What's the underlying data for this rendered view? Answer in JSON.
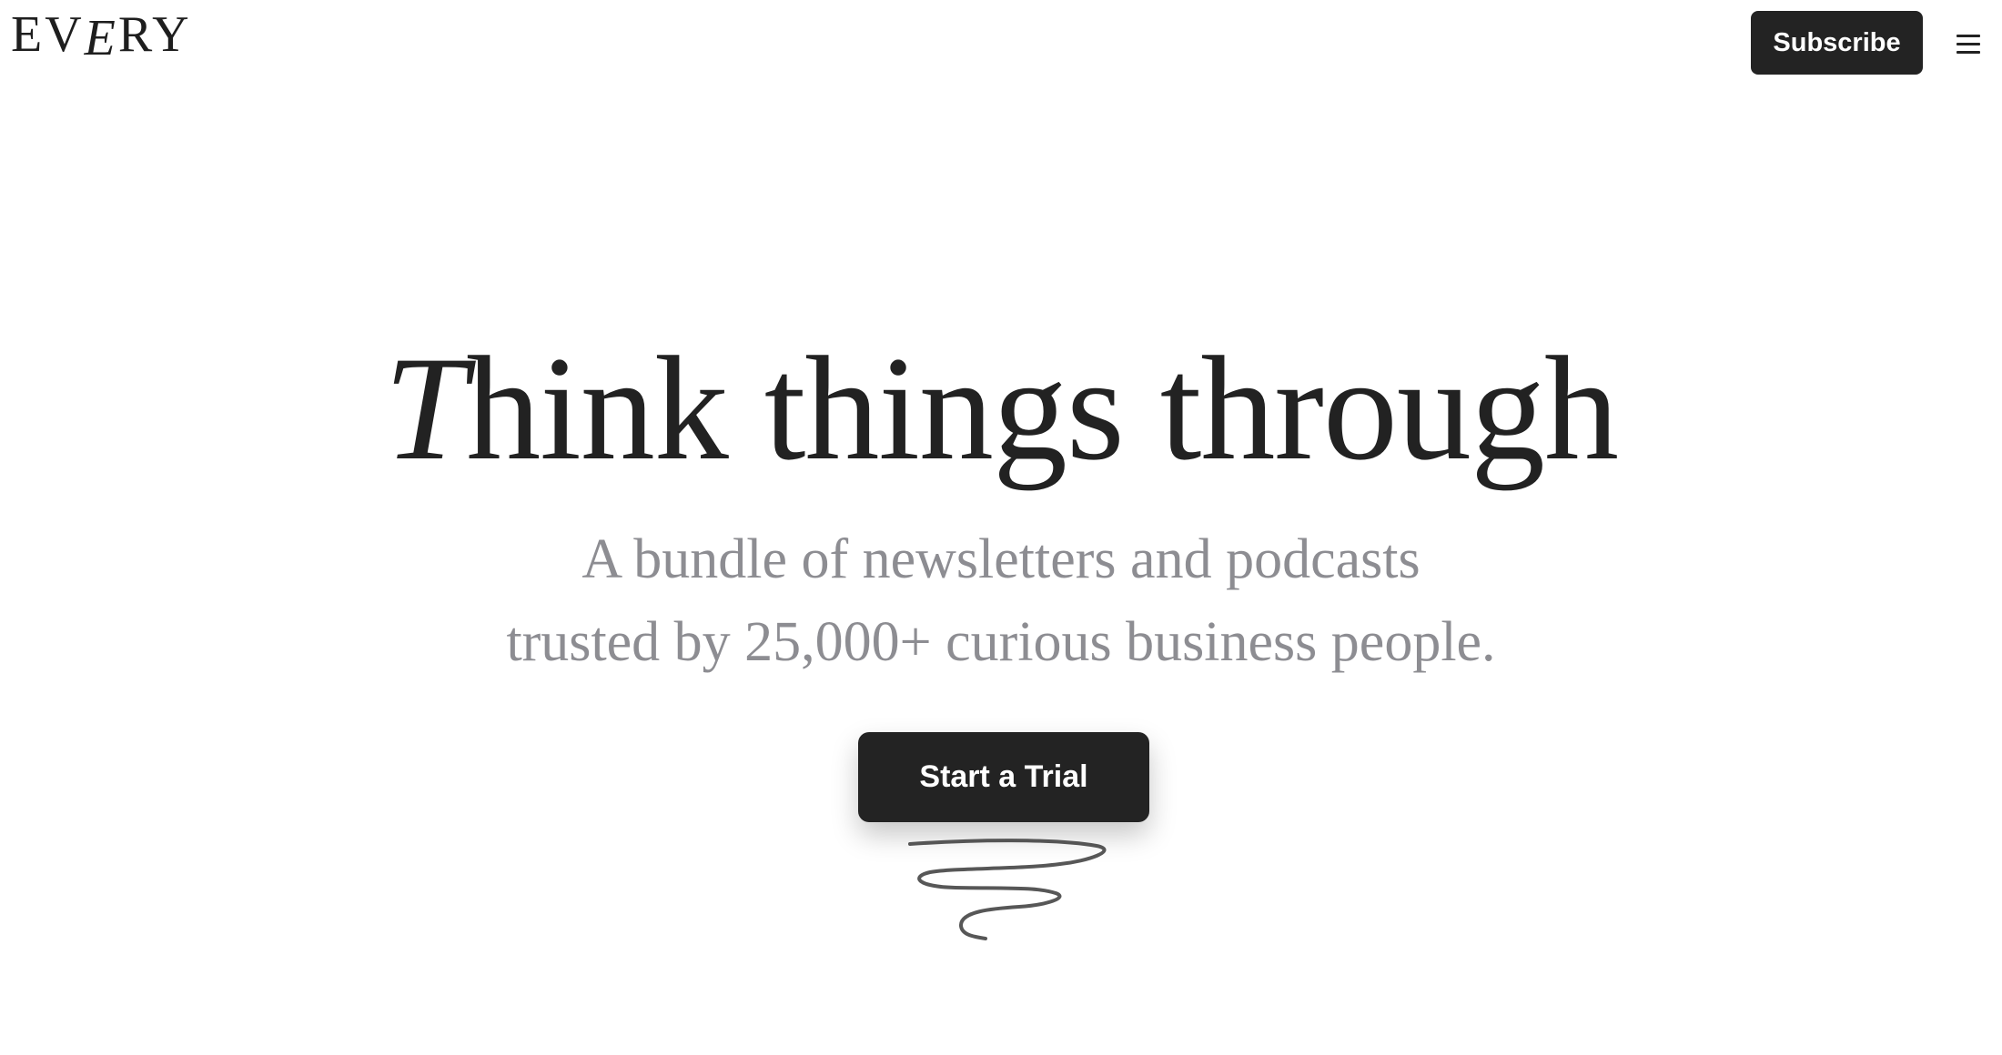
{
  "header": {
    "logo": {
      "pre": "EV",
      "special": "E",
      "post": "RY"
    },
    "subscribe_label": "Subscribe",
    "menu_icon": "hamburger-icon"
  },
  "hero": {
    "title_first": "T",
    "title_rest": "hink things through",
    "subtitle_line1": "A bundle of newsletters and podcasts",
    "subtitle_line2": "trusted by 25,000+ curious business people.",
    "cta_label": "Start a Trial",
    "decoration_icon": "scribble-icon"
  },
  "colors": {
    "text": "#222222",
    "subtitle": "#8d8d92",
    "button_bg": "#232323",
    "button_text": "#ffffff"
  }
}
